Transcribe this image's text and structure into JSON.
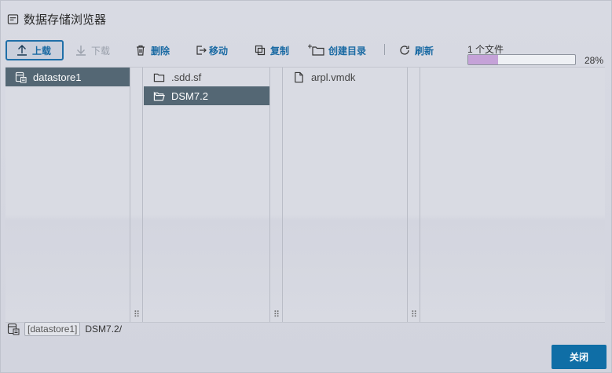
{
  "dialog": {
    "title": "数据存储浏览器"
  },
  "toolbar": {
    "upload": "上载",
    "download": "下载",
    "delete": "删除",
    "move": "移动",
    "copy": "复制",
    "new_folder": "创建目录",
    "refresh": "刷新"
  },
  "progress": {
    "label": "1 个文件",
    "percent_text": "28%",
    "value": 0.28
  },
  "columns": {
    "datastores": [
      "datastore1"
    ],
    "folders": [
      ".sdd.sf",
      "DSM7.2"
    ],
    "files": [
      "arpl.vmdk"
    ]
  },
  "path": {
    "datastore": "[datastore1]",
    "folder": "DSM7.2/"
  },
  "footer": {
    "close": "关闭"
  },
  "colors": {
    "accent": "#0f6ea6",
    "selected": "#546774",
    "progress_fill": "#c5a2d8"
  }
}
